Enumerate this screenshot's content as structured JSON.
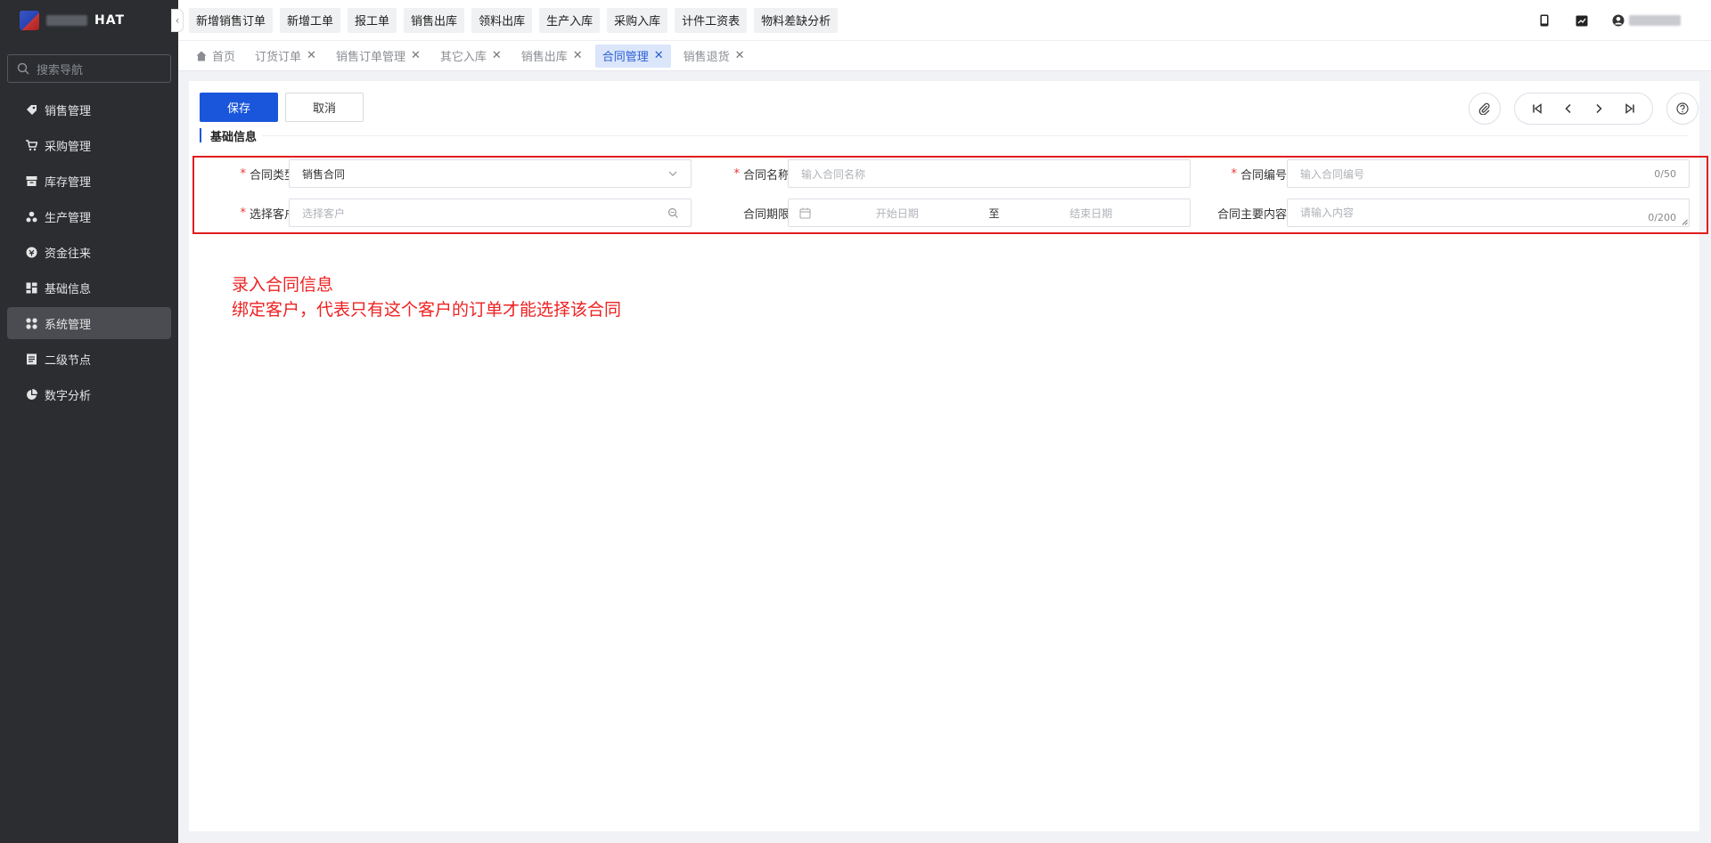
{
  "sidebar": {
    "logo_text": "HAT",
    "search_placeholder": "搜索导航",
    "items": [
      {
        "label": "销售管理",
        "icon": "tag-icon"
      },
      {
        "label": "采购管理",
        "icon": "cart-icon"
      },
      {
        "label": "库存管理",
        "icon": "warehouse-icon"
      },
      {
        "label": "生产管理",
        "icon": "production-icon"
      },
      {
        "label": "资金往来",
        "icon": "money-icon"
      },
      {
        "label": "基础信息",
        "icon": "info-icon"
      },
      {
        "label": "系统管理",
        "icon": "system-icon",
        "active": true
      },
      {
        "label": "二级节点",
        "icon": "document-icon"
      },
      {
        "label": "数字分析",
        "icon": "pie-icon"
      }
    ]
  },
  "topbar": {
    "quick_buttons": [
      "新增销售订单",
      "新增工单",
      "报工单",
      "销售出库",
      "领料出库",
      "生产入库",
      "采购入库",
      "计件工资表",
      "物料差缺分析"
    ]
  },
  "tabs": [
    {
      "label": "首页",
      "closable": false,
      "active": false
    },
    {
      "label": "订货订单",
      "closable": true,
      "active": false
    },
    {
      "label": "销售订单管理",
      "closable": true,
      "active": false
    },
    {
      "label": "其它入库",
      "closable": true,
      "active": false
    },
    {
      "label": "销售出库",
      "closable": true,
      "active": false
    },
    {
      "label": "合同管理",
      "closable": true,
      "active": true
    },
    {
      "label": "销售退货",
      "closable": true,
      "active": false
    }
  ],
  "toolbar": {
    "save_label": "保存",
    "cancel_label": "取消"
  },
  "section": {
    "title": "基础信息"
  },
  "form": {
    "contract_type": {
      "label": "合同类型",
      "value": "销售合同"
    },
    "contract_name": {
      "label": "合同名称",
      "placeholder": "输入合同名称"
    },
    "contract_no": {
      "label": "合同编号",
      "placeholder": "输入合同编号",
      "count": "0/50"
    },
    "customer": {
      "label": "选择客户",
      "placeholder": "选择客户"
    },
    "period": {
      "label": "合同期限",
      "start_placeholder": "开始日期",
      "separator": "至",
      "end_placeholder": "结束日期"
    },
    "content": {
      "label": "合同主要内容",
      "placeholder": "请输入内容",
      "count": "0/200"
    }
  },
  "annotation": {
    "line1": "录入合同信息",
    "line2": "绑定客户，代表只有这个客户的订单才能选择该合同"
  },
  "colors": {
    "primary": "#1a56db",
    "highlight_border": "#e01e1e",
    "sidebar_bg": "#2b2d31"
  }
}
